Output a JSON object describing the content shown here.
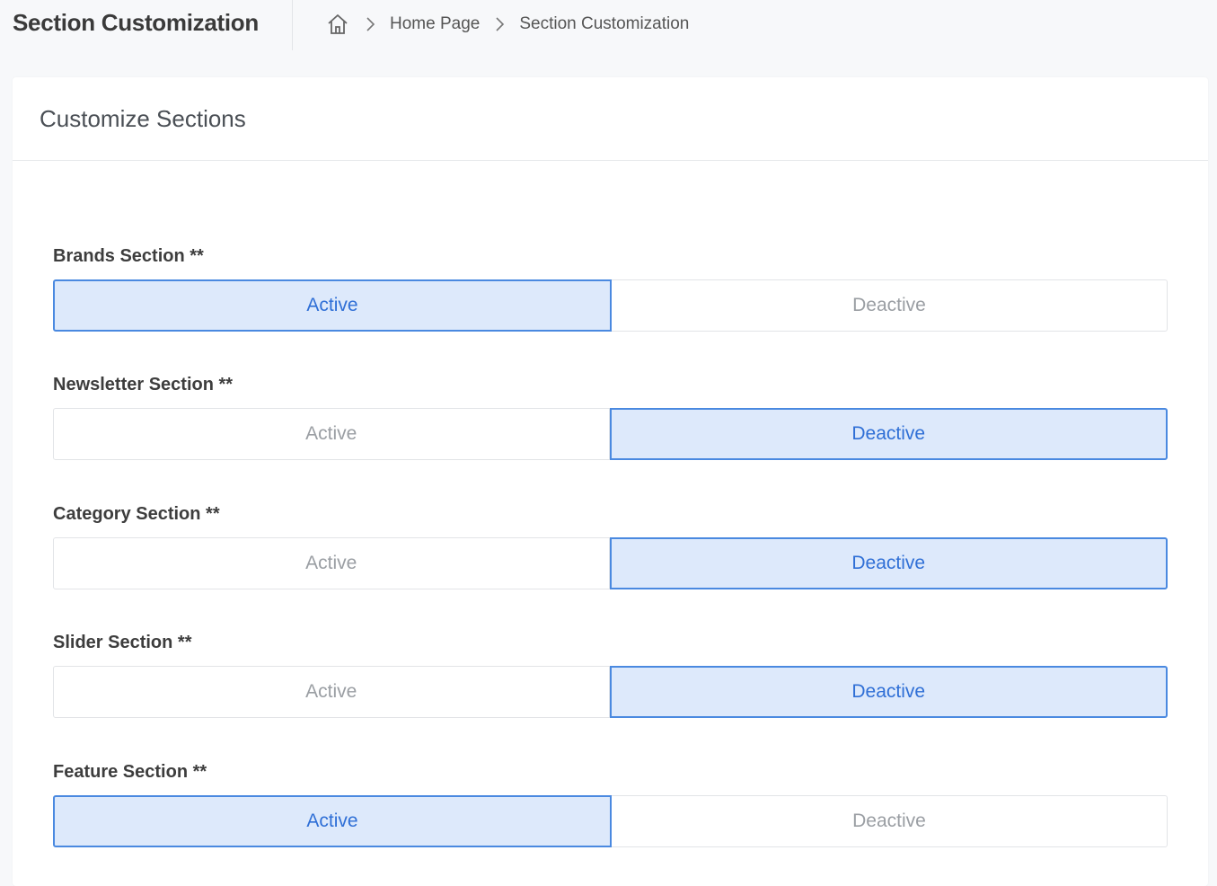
{
  "header": {
    "title": "Section Customization",
    "breadcrumb": {
      "home_icon": "home-icon",
      "items": [
        "Home Page",
        "Section Customization"
      ]
    }
  },
  "card": {
    "title": "Customize Sections"
  },
  "sections": [
    {
      "label": "Brands Section **",
      "options": [
        "Active",
        "Deactive"
      ],
      "selected": "Active"
    },
    {
      "label": "Newsletter Section **",
      "options": [
        "Active",
        "Deactive"
      ],
      "selected": "Deactive"
    },
    {
      "label": "Category Section **",
      "options": [
        "Active",
        "Deactive"
      ],
      "selected": "Deactive"
    },
    {
      "label": "Slider Section **",
      "options": [
        "Active",
        "Deactive"
      ],
      "selected": "Deactive"
    },
    {
      "label": "Feature Section **",
      "options": [
        "Active",
        "Deactive"
      ],
      "selected": "Active"
    }
  ],
  "colors": {
    "selected_bg": "#dde9fb",
    "selected_border": "#4a89e0",
    "selected_text": "#2f6fd6",
    "unselected_text": "#9a9ea3"
  }
}
